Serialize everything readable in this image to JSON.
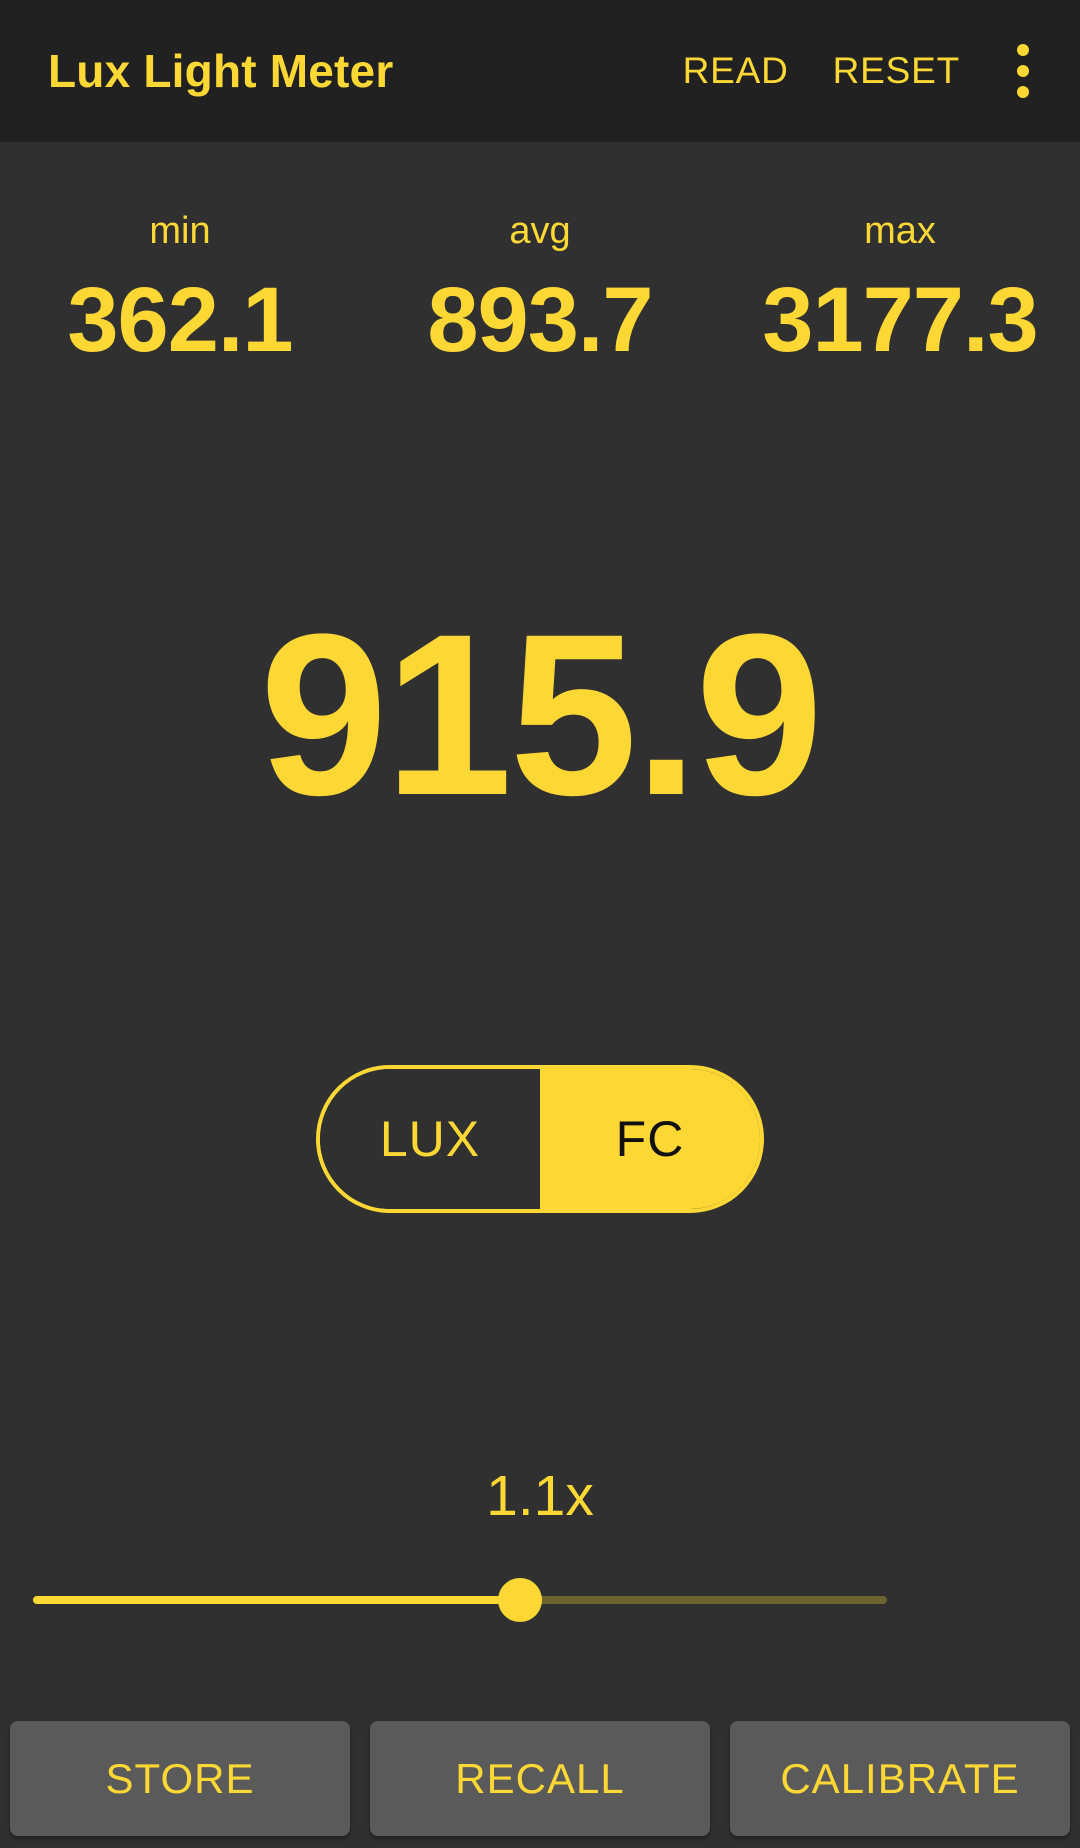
{
  "app": {
    "title": "Lux Light Meter",
    "accent_color": "#FDD835",
    "background_color": "#303030",
    "appbar_color": "#212121",
    "button_color": "#5a5a5a"
  },
  "appbar": {
    "read_label": "READ",
    "reset_label": "RESET",
    "overflow_icon": "more-vert-icon"
  },
  "stats": [
    {
      "label": "min",
      "value": "362.1"
    },
    {
      "label": "avg",
      "value": "893.7"
    },
    {
      "label": "max",
      "value": "3177.3"
    }
  ],
  "reading": {
    "value": "915.9"
  },
  "unit_toggle": {
    "options": [
      {
        "label": "LUX",
        "selected": false
      },
      {
        "label": "FC",
        "selected": true
      }
    ]
  },
  "zoom_control": {
    "multiplier_label": "1.1x",
    "slider_percent": 57
  },
  "bottom_actions": {
    "store_label": "STORE",
    "recall_label": "RECALL",
    "calibrate_label": "CALIBRATE"
  }
}
